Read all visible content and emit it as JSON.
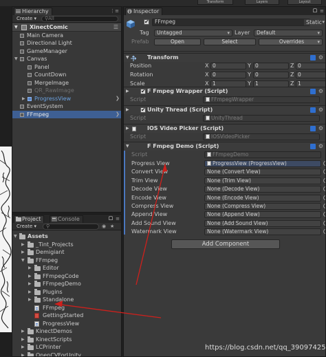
{
  "topbar": {
    "buttons": [
      "Transform",
      "Layers",
      "Layout"
    ]
  },
  "hierarchy": {
    "tab_label": "Hierarchy",
    "create_label": "Create",
    "search_placeholder": "All",
    "scene_name": "XinectComic",
    "items": [
      {
        "label": "Main Camera",
        "depth": 1,
        "expandable": false,
        "style": "normal"
      },
      {
        "label": "Directional Light",
        "depth": 1,
        "expandable": false,
        "style": "normal"
      },
      {
        "label": "GameManager",
        "depth": 1,
        "expandable": false,
        "style": "normal"
      },
      {
        "label": "Canvas",
        "depth": 1,
        "expandable": true,
        "style": "normal"
      },
      {
        "label": "Panel",
        "depth": 2,
        "expandable": false,
        "style": "normal"
      },
      {
        "label": "CountDown",
        "depth": 2,
        "expandable": false,
        "style": "normal"
      },
      {
        "label": "MergeImage",
        "depth": 2,
        "expandable": false,
        "style": "normal"
      },
      {
        "label": "QR_RawImage",
        "depth": 2,
        "expandable": false,
        "style": "dim"
      },
      {
        "label": "ProgressView",
        "depth": 2,
        "expandable": true,
        "style": "blue"
      },
      {
        "label": "EventSystem",
        "depth": 1,
        "expandable": false,
        "style": "normal"
      },
      {
        "label": "FFmpeg",
        "depth": 1,
        "expandable": false,
        "style": "selected"
      }
    ]
  },
  "project": {
    "tab_label": "Project",
    "console_tab_label": "Console",
    "create_label": "Create",
    "root_label": "Assets",
    "items": [
      {
        "label": "_Tint_Projects",
        "depth": 1,
        "kind": "folder",
        "expandable": true
      },
      {
        "label": "Demigiant",
        "depth": 1,
        "kind": "folder",
        "expandable": true
      },
      {
        "label": "FFmpeg",
        "depth": 1,
        "kind": "folder",
        "expandable": true,
        "open": true
      },
      {
        "label": "Editor",
        "depth": 2,
        "kind": "folder",
        "expandable": true
      },
      {
        "label": "FFmpegCode",
        "depth": 2,
        "kind": "folder",
        "expandable": true
      },
      {
        "label": "FFmpegDemo",
        "depth": 2,
        "kind": "folder",
        "expandable": true
      },
      {
        "label": "Plugins",
        "depth": 2,
        "kind": "folder",
        "expandable": true
      },
      {
        "label": "Standalone",
        "depth": 2,
        "kind": "folder",
        "expandable": true
      },
      {
        "label": "FFmpeg",
        "depth": 2,
        "kind": "script",
        "expandable": false
      },
      {
        "label": "GettingStarted",
        "depth": 2,
        "kind": "pdf",
        "expandable": false
      },
      {
        "label": "ProgressView",
        "depth": 2,
        "kind": "script",
        "expandable": false
      },
      {
        "label": "KinectDemos",
        "depth": 1,
        "kind": "folder",
        "expandable": true
      },
      {
        "label": "KinectScripts",
        "depth": 1,
        "kind": "folder",
        "expandable": true
      },
      {
        "label": "LCPrinter",
        "depth": 1,
        "kind": "folder",
        "expandable": true
      },
      {
        "label": "OpenCVForUnity",
        "depth": 1,
        "kind": "folder",
        "expandable": true
      }
    ]
  },
  "inspector": {
    "tab_label": "Inspector",
    "object_name": "FFmpeg",
    "static_label": "Static",
    "tag_label": "Tag",
    "tag_value": "Untagged",
    "layer_label": "Layer",
    "layer_value": "Default",
    "prefab_label": "Prefab",
    "prefab_buttons": [
      "Open",
      "Select",
      "Overrides"
    ],
    "transform": {
      "title": "Transform",
      "rows": [
        {
          "label": "Position",
          "x": "0",
          "y": "0",
          "z": "0"
        },
        {
          "label": "Rotation",
          "x": "0",
          "y": "0",
          "z": "0"
        },
        {
          "label": "Scale",
          "x": "1",
          "y": "1",
          "z": "1"
        }
      ]
    },
    "components": [
      {
        "title": "F Fmpeg Wrapper (Script)",
        "has_checkbox": true,
        "script_label": "Script",
        "script_value": "FFmpegWrapper"
      },
      {
        "title": "Unity Thread (Script)",
        "has_checkbox": true,
        "script_label": "Script",
        "script_value": "UnityThread"
      },
      {
        "title": "IOS Video Picker (Script)",
        "has_checkbox": false,
        "script_label": "Script",
        "script_value": "IOSVideoPicker"
      }
    ],
    "demo": {
      "title": "F Fmpeg Demo (Script)",
      "script_label": "Script",
      "script_value": "FFmpegDemo",
      "fields": [
        {
          "label": "Progress View",
          "value": "ProgressView (ProgressView)",
          "highlight": true
        },
        {
          "label": "Convert View",
          "value": "None (Convert View)"
        },
        {
          "label": "Trim View",
          "value": "None (Trim View)"
        },
        {
          "label": "Decode View",
          "value": "None (Decode View)"
        },
        {
          "label": "Encode View",
          "value": "None (Encode View)"
        },
        {
          "label": "Compress View",
          "value": "None (Compress View)"
        },
        {
          "label": "Append View",
          "value": "None (Append View)"
        },
        {
          "label": "Add Sound View",
          "value": "None (Add Sound View)"
        },
        {
          "label": "Watermark View",
          "value": "None (Watermark View)"
        }
      ]
    },
    "add_component_label": "Add Component"
  },
  "watermark": "https://blog.csdn.net/qq_39097425",
  "colors": {
    "selection": "#3e5f93",
    "annotation_arrow": "#d0201c",
    "object_ref_highlight": "#3d4a63"
  }
}
